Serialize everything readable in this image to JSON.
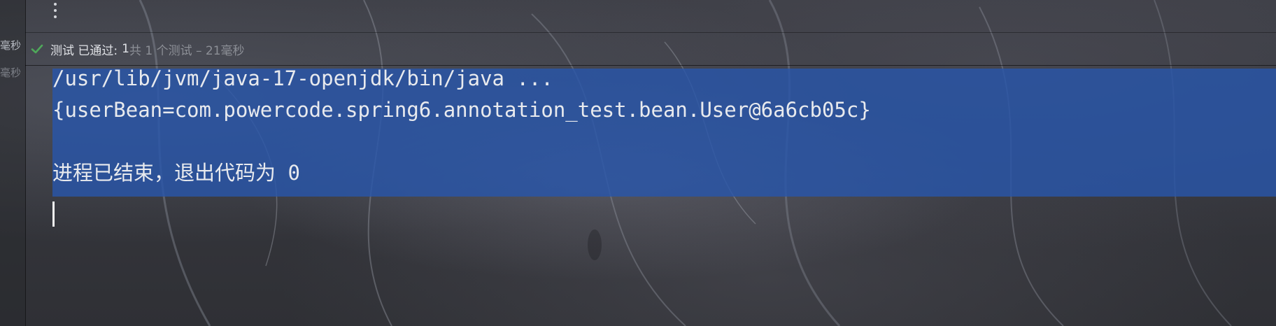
{
  "toolbar": {
    "more_icon": "kebab-vertical-icon"
  },
  "gutter": {
    "items": [
      {
        "label": "毫秒"
      },
      {
        "label": "毫秒"
      }
    ]
  },
  "test_status": {
    "icon": "check-icon",
    "icon_color": "#4fa85a",
    "summary": "测试 已通过:",
    "count": "1",
    "detail": "共 1 个测试 – 21毫秒"
  },
  "console": {
    "selection_color": "#2856aa",
    "lines": [
      "/usr/lib/jvm/java-17-openjdk/bin/java ...",
      "{userBean=com.powercode.spring6.annotation_test.bean.User@6a6cb05c}",
      "",
      "进程已结束，退出代码为 0"
    ]
  }
}
